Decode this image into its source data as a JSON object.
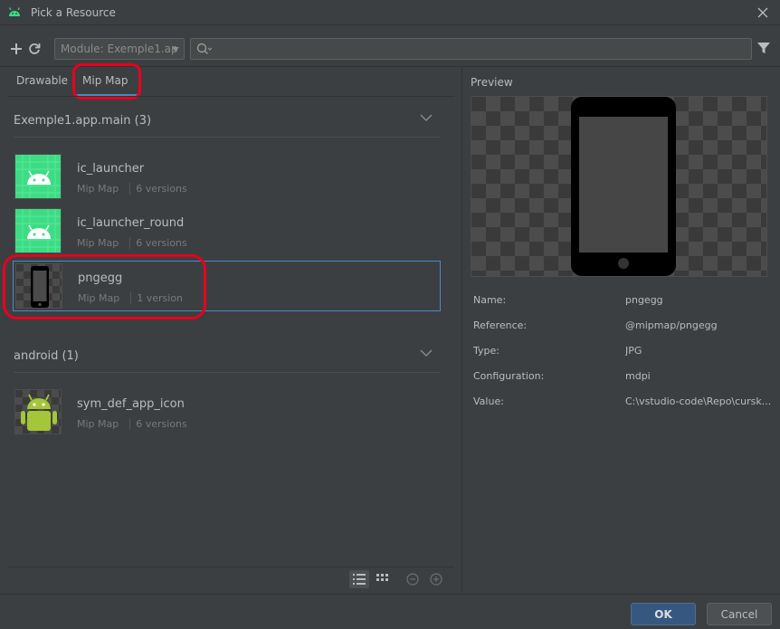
{
  "window": {
    "title": "Pick a Resource"
  },
  "toolbar": {
    "add_icon": "plus-icon",
    "refresh_icon": "refresh-icon",
    "module_select": "Module: Exemple1.ap",
    "search_placeholder": "",
    "filter_icon": "filter-icon"
  },
  "tabs": [
    {
      "label": "Drawable",
      "selected": false
    },
    {
      "label": "Mip Map",
      "selected": true
    }
  ],
  "groups": [
    {
      "title": "Exemple1.app.main (3)",
      "items": [
        {
          "name": "ic_launcher",
          "type": "Mip Map",
          "versions": "6 versions"
        },
        {
          "name": "ic_launcher_round",
          "type": "Mip Map",
          "versions": "6 versions"
        },
        {
          "name": "pngegg",
          "type": "Mip Map",
          "versions": "1 version",
          "selected": true
        }
      ]
    },
    {
      "title": "android (1)",
      "items": [
        {
          "name": "sym_def_app_icon",
          "type": "Mip Map",
          "versions": "6 versions"
        }
      ]
    }
  ],
  "preview": {
    "label": "Preview",
    "properties": [
      {
        "key": "Name:",
        "value": "pngegg"
      },
      {
        "key": "Reference:",
        "value": "@mipmap/pngegg"
      },
      {
        "key": "Type:",
        "value": "JPG"
      },
      {
        "key": "Configuration:",
        "value": "mdpi"
      },
      {
        "key": "Value:",
        "value": "C:\\vstudio-code\\Repo\\cursk..."
      }
    ]
  },
  "footer": {
    "ok_label": "OK",
    "cancel_label": "Cancel"
  },
  "colors": {
    "accent": "#4a88c7",
    "highlight_ring": "#e8001c",
    "launcher_green": "#3ddc84",
    "android_green": "#a4c639"
  }
}
